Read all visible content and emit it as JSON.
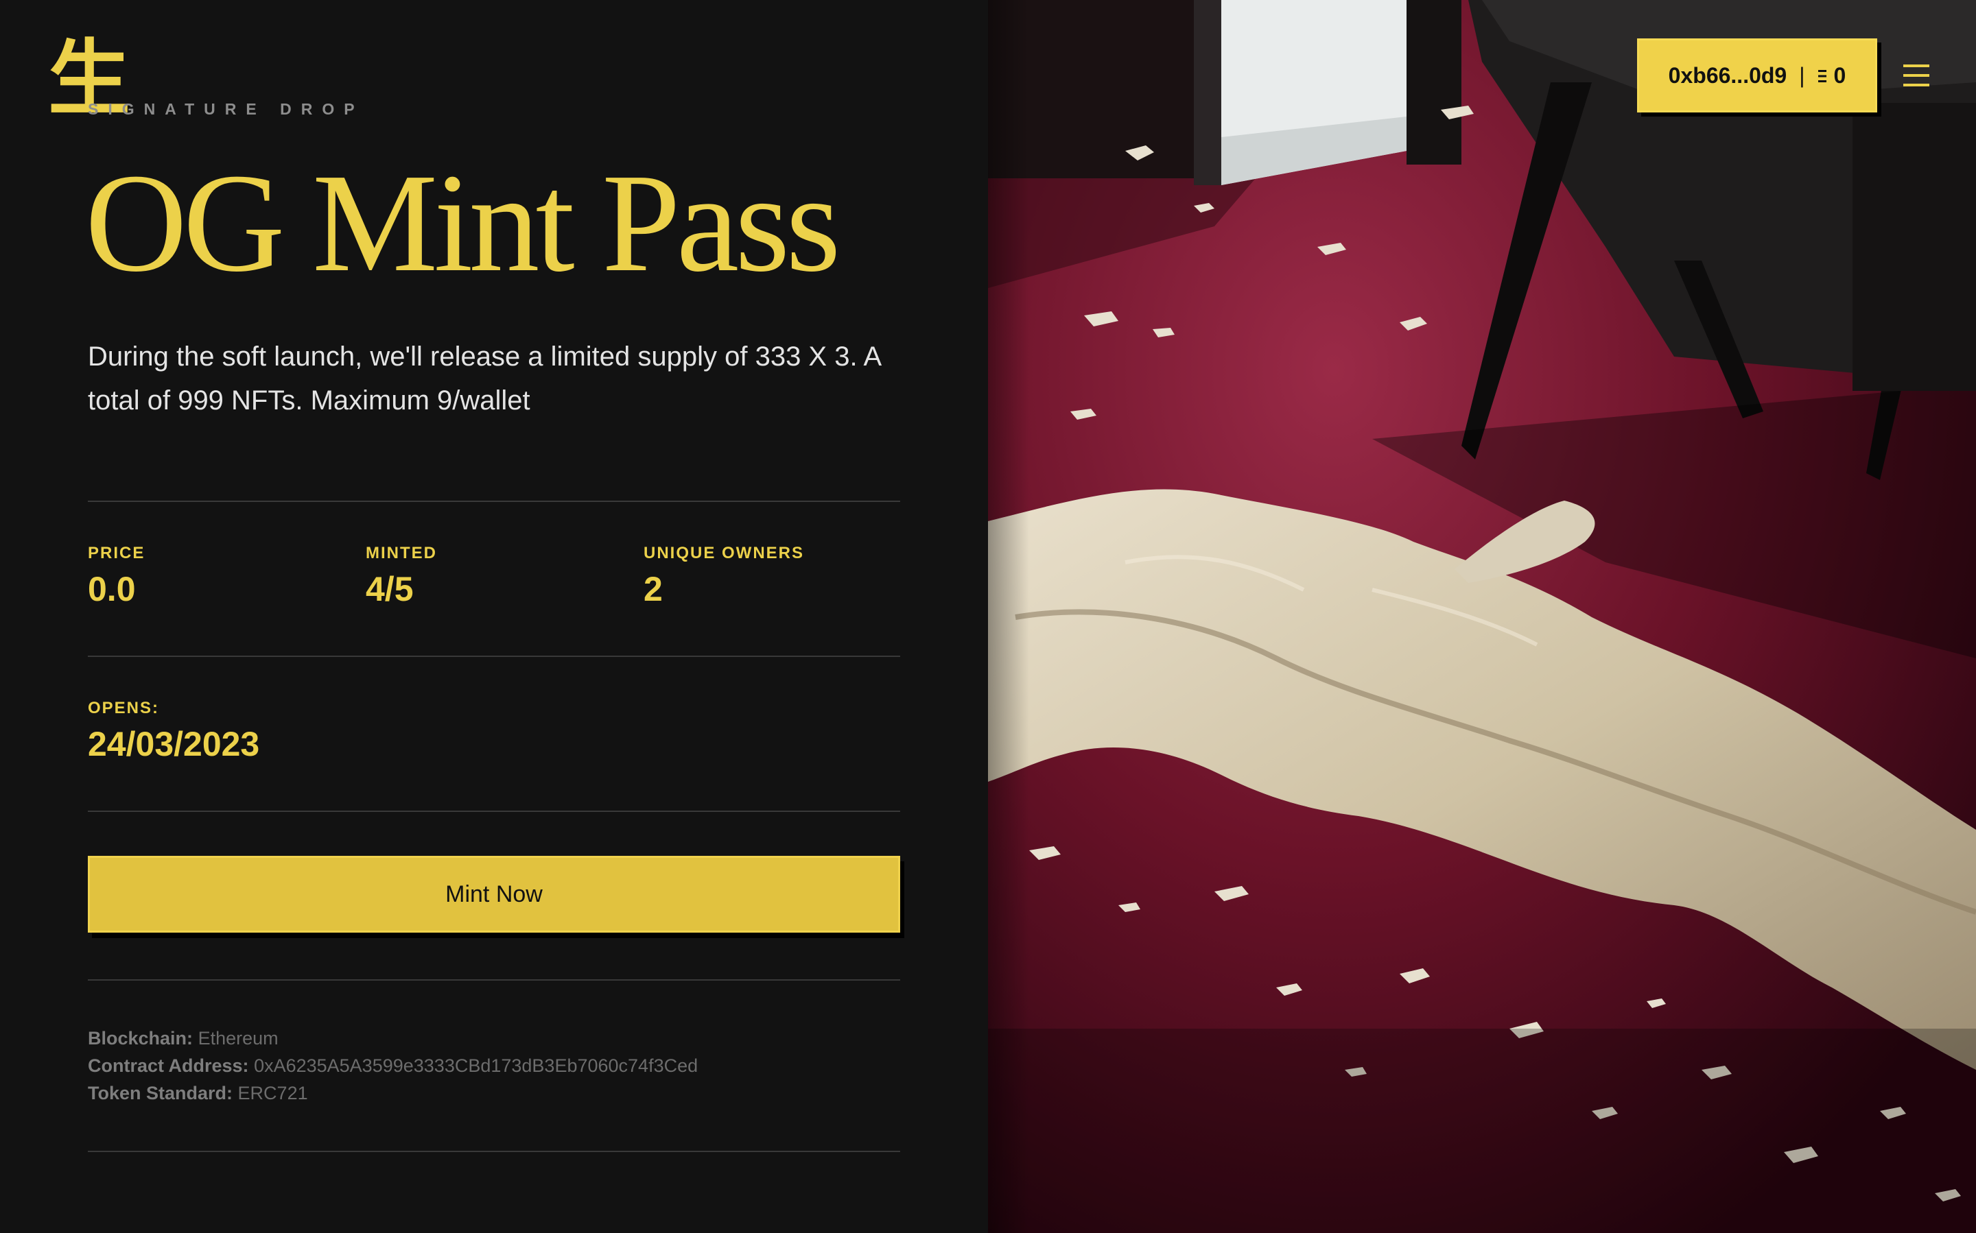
{
  "brand": {
    "logo_glyph": "生",
    "eyebrow": "SIGNATURE DROP"
  },
  "drop": {
    "title": "OG Mint Pass",
    "description": "During the soft launch, we'll release a limited supply of 333 X 3. A total of 999 NFTs. Maximum 9/wallet"
  },
  "stats": {
    "price_label": "PRICE",
    "price_value": "0.0",
    "minted_label": "MINTED",
    "minted_value": "4/5",
    "owners_label": "UNIQUE OWNERS",
    "owners_value": "2",
    "opens_label": "OPENS:",
    "opens_value": "24/03/2023"
  },
  "actions": {
    "mint_label": "Mint Now"
  },
  "contract": {
    "blockchain_label": "Blockchain:",
    "blockchain_value": "Ethereum",
    "address_label": "Contract Address:",
    "address_value": "0xA6235A5A3599e3333CBd173dB3Eb7060c74f3Ced",
    "standard_label": "Token Standard:",
    "standard_value": "ERC721"
  },
  "wallet": {
    "address": "0xb66...0d9",
    "separator": "|",
    "balance": "0",
    "currency_icon": "ethereum-icon"
  },
  "menu": {
    "icon": "hamburger-menu-icon"
  },
  "colors": {
    "accent": "#ECD14A",
    "background": "#121212",
    "carpet": "#6F1428"
  }
}
